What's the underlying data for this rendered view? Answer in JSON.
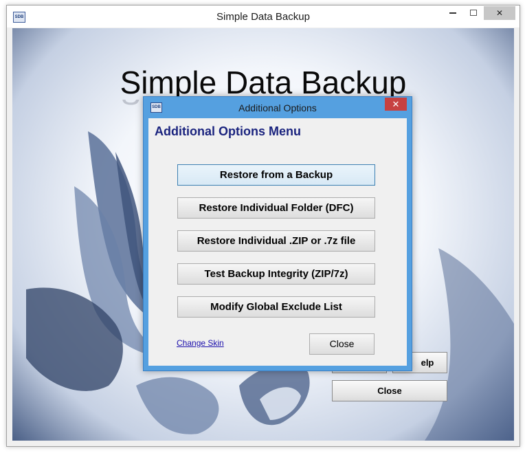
{
  "main_window": {
    "title": "Simple Data Backup",
    "icon_label": "SDB",
    "skin_title": "Simple Data Backup",
    "buttons": {
      "help_label": "elp",
      "close_label": "Close"
    }
  },
  "dialog": {
    "title": "Additional Options",
    "icon_label": "SDB",
    "close_glyph": "✕",
    "menu_title": "Additional Options Menu",
    "options": [
      {
        "label": "Restore from a Backup"
      },
      {
        "label": "Restore Individual Folder (DFC)"
      },
      {
        "label": "Restore Individual .ZIP or .7z file"
      },
      {
        "label": "Test Backup Integrity (ZIP/7z)"
      },
      {
        "label": "Modify Global Exclude List"
      }
    ],
    "change_skin_label": "Change Skin",
    "close_label": "Close"
  },
  "colors": {
    "menu_title": "#1a237e",
    "dialog_frame": "#55a0e0",
    "dialog_close": "#c74141",
    "link": "#1a0dab"
  }
}
